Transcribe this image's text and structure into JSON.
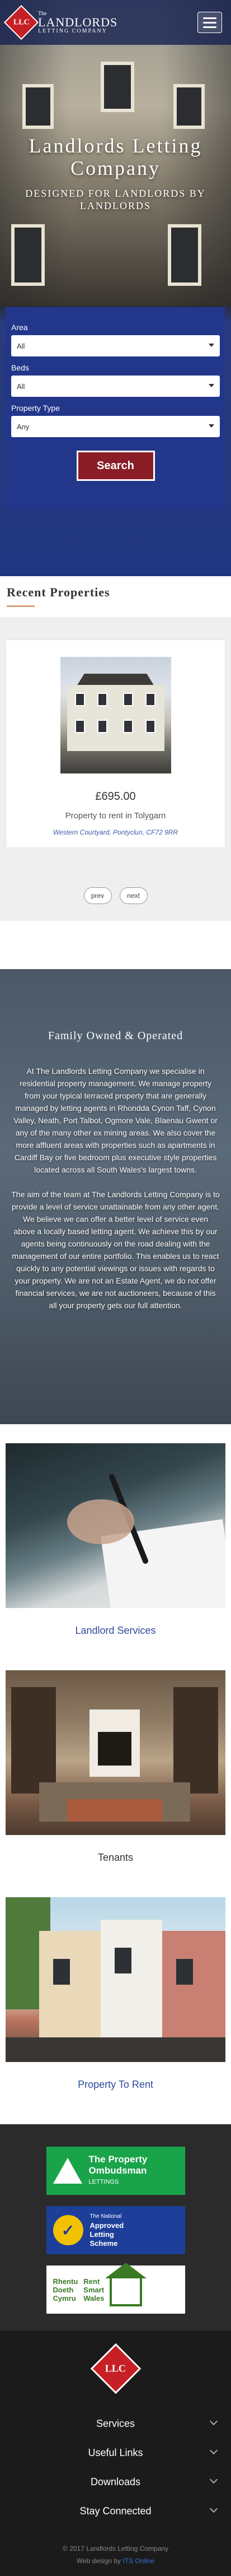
{
  "header": {
    "logo_badge": "LLC",
    "logo_small": "The",
    "logo_name": "LANDLORDS",
    "logo_tag": "LETTING COMPANY"
  },
  "hero": {
    "title": "Landlords Letting Company",
    "subtitle": "DESIGNED FOR LANDLORDS BY LANDLORDS"
  },
  "search": {
    "area_label": "Area",
    "area_value": "All",
    "beds_label": "Beds",
    "beds_value": "All",
    "type_label": "Property Type",
    "type_value": "Any",
    "button_label": "Search"
  },
  "recent": {
    "title": "Recent Properties",
    "property": {
      "price": "£695.00",
      "description": "Property to rent in Tolygarn",
      "address": "Western Courtyard, Pontyclun, CF72 9RR"
    },
    "prev_label": "prev",
    "next_label": "next"
  },
  "family": {
    "title": "Family Owned & Operated",
    "para1": "At The Landlords Letting Company we specialise in residential property management. We manage property from your typical terraced property that are generally managed by letting agents in Rhondda Cynon Taff, Cynon Valley, Neath, Port Talbot, Ogmore Vale, Blaenau Gwent or any of the many other ex mining areas. We also cover the more affluent areas with properties such as apartments in Cardiff Bay or five bedroom plus executive style properties located across all South Wales's largest towns.",
    "para2": "The aim of the team at The Landlords Letting Company is to provide a level of service unattainable from any other agent. We believe we can offer a better level of service even above a locally based letting agent. We achieve this by our agents being continuously on the road dealing with the management of our entire portfolio. This enables us to react quickly to any potential viewings or issues with regards to your property. We are not an Estate Agent, we do not offer financial services, we are not auctioneers, because of this all your property gets our full attention."
  },
  "tiles": [
    {
      "label": "Landlord Services"
    },
    {
      "label": "Tenants"
    },
    {
      "label": "Property To Rent"
    }
  ],
  "logos": {
    "ombudsman_line1": "The Property",
    "ombudsman_line2": "Ombudsman",
    "ombudsman_line3": "LETTINGS",
    "nals_small": "The National",
    "nals_line1": "Approved",
    "nals_line2": "Letting",
    "nals_line3": "Scheme",
    "rsw_line1": "Rhentu",
    "rsw_line2": "Doeth",
    "rsw_line3": "Cymru",
    "rsw_line4": "Rent",
    "rsw_line5": "Smart",
    "rsw_line6": "Wales"
  },
  "footer": {
    "badge": "LLC",
    "links": [
      "Services",
      "Useful Links",
      "Downloads",
      "Stay Connected"
    ],
    "copyright": "© 2017 Landlords Letting Company",
    "credit_prefix": "Web design by",
    "credit_link": "ITS Online"
  }
}
